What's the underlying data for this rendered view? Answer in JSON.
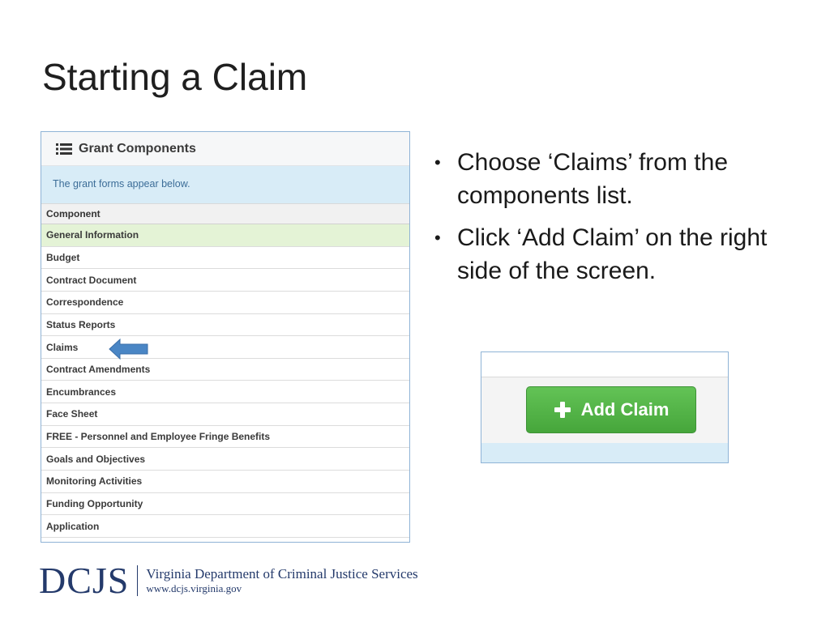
{
  "slide": {
    "title": "Starting a Claim"
  },
  "panel": {
    "title": "Grant Components",
    "info": "The grant forms appear below.",
    "column_header": "Component",
    "rows": [
      {
        "label": "General Information",
        "highlighted": true
      },
      {
        "label": "Budget"
      },
      {
        "label": "Contract Document"
      },
      {
        "label": "Correspondence"
      },
      {
        "label": "Status Reports"
      },
      {
        "label": "Claims"
      },
      {
        "label": "Contract Amendments"
      },
      {
        "label": "Encumbrances"
      },
      {
        "label": "Face Sheet"
      },
      {
        "label": "FREE - Personnel and Employee Fringe Benefits"
      },
      {
        "label": "Goals and Objectives"
      },
      {
        "label": "Monitoring Activities"
      },
      {
        "label": "Funding Opportunity"
      },
      {
        "label": "Application"
      }
    ]
  },
  "bullets": [
    "Choose ‘Claims’ from the components list.",
    "Click ‘Add Claim’ on the right side of the screen."
  ],
  "add_claim": {
    "label": "Add Claim"
  },
  "footer": {
    "logo_mark": "DCJS",
    "org_name": "Virginia Department of Criminal Justice Services",
    "url": "www.dcjs.virginia.gov"
  },
  "colors": {
    "panel_border": "#8fb3d6",
    "info_bar": "#d8ecf7",
    "highlight_row": "#e4f3d6",
    "button_green": "#4cae41",
    "arrow_blue": "#4a86c5",
    "logo_navy": "#243a6b"
  },
  "icons": {
    "panel_header": "list-icon",
    "button": "plus-icon",
    "pointer": "left-arrow-icon"
  }
}
